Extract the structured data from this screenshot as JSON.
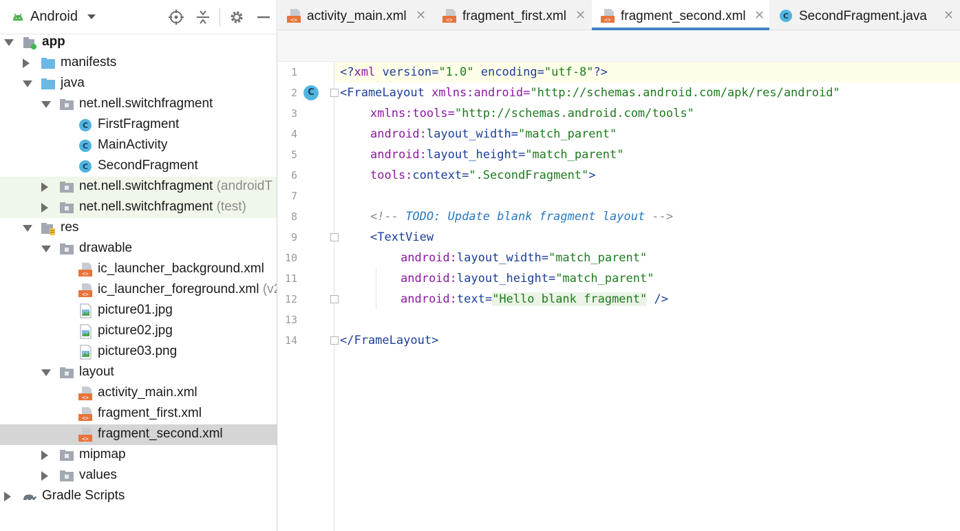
{
  "project_panel": {
    "title": "Android"
  },
  "tree": [
    {
      "label": "app",
      "suffix": "",
      "bold": true
    },
    {
      "label": "manifests",
      "suffix": ""
    },
    {
      "label": "java",
      "suffix": ""
    },
    {
      "label": "net.nell.switchfragment",
      "suffix": ""
    },
    {
      "label": "FirstFragment",
      "suffix": ""
    },
    {
      "label": "MainActivity",
      "suffix": ""
    },
    {
      "label": "SecondFragment",
      "suffix": ""
    },
    {
      "label": "net.nell.switchfragment",
      "suffix": " (androidT"
    },
    {
      "label": "net.nell.switchfragment",
      "suffix": " (test)"
    },
    {
      "label": "res",
      "suffix": ""
    },
    {
      "label": "drawable",
      "suffix": ""
    },
    {
      "label": "ic_launcher_background.xml",
      "suffix": ""
    },
    {
      "label": "ic_launcher_foreground.xml",
      "suffix": " (v2"
    },
    {
      "label": "picture01.jpg",
      "suffix": ""
    },
    {
      "label": "picture02.jpg",
      "suffix": ""
    },
    {
      "label": "picture03.png",
      "suffix": ""
    },
    {
      "label": "layout",
      "suffix": ""
    },
    {
      "label": "activity_main.xml",
      "suffix": ""
    },
    {
      "label": "fragment_first.xml",
      "suffix": ""
    },
    {
      "label": "fragment_second.xml",
      "suffix": ""
    },
    {
      "label": "mipmap",
      "suffix": ""
    },
    {
      "label": "values",
      "suffix": ""
    },
    {
      "label": "Gradle Scripts",
      "suffix": ""
    }
  ],
  "tabs": [
    {
      "label": "activity_main.xml",
      "active": false
    },
    {
      "label": "fragment_first.xml",
      "active": false
    },
    {
      "label": "fragment_second.xml",
      "active": true
    },
    {
      "label": "SecondFragment.java",
      "active": false
    }
  ],
  "tab_close_glyph": "✕",
  "class_marker_letter": "C",
  "line_numbers": [
    "1",
    "2",
    "3",
    "4",
    "5",
    "6",
    "7",
    "8",
    "9",
    "10",
    "11",
    "12",
    "13",
    "14"
  ],
  "code": {
    "l1_open": "<?",
    "l1_xml": "xml",
    "l1_version_attr": " version=",
    "l1_version_val": "\"1.0\"",
    "l1_enc_attr": " encoding=",
    "l1_enc_val": "\"utf-8\"",
    "l1_close": "?>",
    "l2_tag": "<FrameLayout ",
    "l2_ns": "xmlns:android=",
    "l2_val": "\"http://schemas.android.com/apk/res/android\"",
    "l3_ns": "xmlns:tools=",
    "l3_val": "\"http://schemas.android.com/tools\"",
    "l4_ns": "android:",
    "l4_attr": "layout_width=",
    "l4_val": "\"match_parent\"",
    "l5_ns": "android:",
    "l5_attr": "layout_height=",
    "l5_val": "\"match_parent\"",
    "l6_ns": "tools:",
    "l6_attr": "context=",
    "l6_val": "\".SecondFragment\"",
    "l6_end": ">",
    "l8_open": "<!-- ",
    "l8_todo": "TODO: Update blank fragment layout",
    "l8_close": " -->",
    "l9_tag": "<TextView",
    "l10_ns": "android:",
    "l10_attr": "layout_width=",
    "l10_val": "\"match_parent\"",
    "l11_ns": "android:",
    "l11_attr": "layout_height=",
    "l11_val": "\"match_parent\"",
    "l12_ns": "android:",
    "l12_attr": "text=",
    "l12_val": "\"Hello blank fragment\"",
    "l12_end": " />",
    "l14_tag": "</FrameLayout>"
  }
}
